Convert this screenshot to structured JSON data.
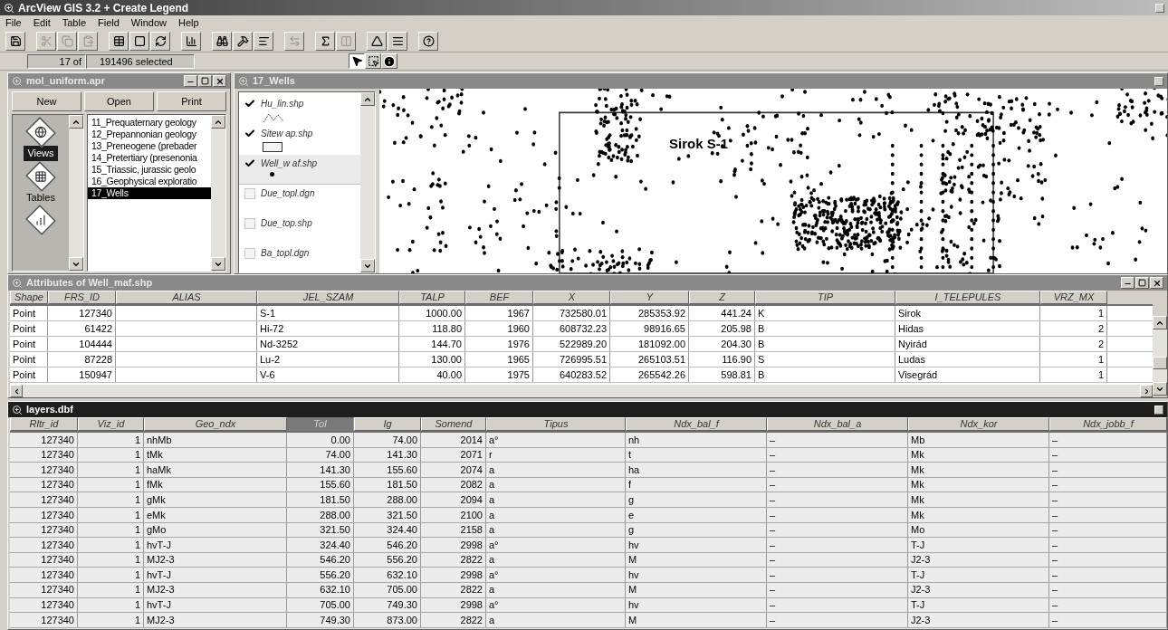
{
  "app": {
    "title": "ArcView GIS 3.2  + Create Legend"
  },
  "menu": [
    "File",
    "Edit",
    "Table",
    "Field",
    "Window",
    "Help"
  ],
  "status": {
    "count": "17 of",
    "selected": "191496 selected"
  },
  "tools": [
    {
      "kind": "pointer",
      "selected": true
    },
    {
      "kind": "vertex",
      "selected": false
    },
    {
      "kind": "identify",
      "selected": false
    }
  ],
  "project": {
    "title": "mol_uniform.apr",
    "buttons": [
      "New",
      "Open",
      "Print"
    ],
    "doc_types": [
      {
        "kind": "views",
        "label": "Views",
        "selected": true
      },
      {
        "kind": "tables",
        "label": "Tables",
        "selected": false
      },
      {
        "kind": "charts",
        "selected": false
      }
    ],
    "items": [
      {
        "label": "11_Prequaternary geology",
        "selected": false
      },
      {
        "label": "12_Prepannonian geology",
        "selected": false
      },
      {
        "label": "13_Preneogene (prebader",
        "selected": false
      },
      {
        "label": "14_Pretertiary (presenonia",
        "selected": false
      },
      {
        "label": "15_Triassic, jurassic geolo",
        "selected": false
      },
      {
        "label": "16_Geophysical exploratio",
        "selected": false
      },
      {
        "label": "17_Wells",
        "selected": true
      }
    ]
  },
  "view": {
    "title": "17_Wells",
    "map_label": "Sirok S-1",
    "legend": [
      {
        "name": "Hu_lin.shp",
        "checked": true,
        "kind": "line",
        "selected": false
      },
      {
        "name": "Sitew ap.shp",
        "checked": true,
        "kind": "polygon",
        "selected": false
      },
      {
        "name": "Well_w af.shp",
        "checked": true,
        "kind": "point",
        "selected": true
      },
      {
        "name": "Due_topl.dgn",
        "checked": false,
        "kind": "none",
        "selected": false
      },
      {
        "name": "Due_top.shp",
        "checked": false,
        "kind": "none",
        "selected": false
      },
      {
        "name": "Ba_topl.dgn",
        "checked": false,
        "kind": "none",
        "selected": false
      }
    ]
  },
  "attributes": {
    "title": "Attributes of Well_maf.shp",
    "columns": [
      {
        "label": "Shape",
        "kind": "text"
      },
      {
        "label": "FRS_ID",
        "kind": "number"
      },
      {
        "label": "ALIAS",
        "kind": "text"
      },
      {
        "label": "JEL_SZAM",
        "kind": "text"
      },
      {
        "label": "TALP",
        "kind": "number"
      },
      {
        "label": "BEF",
        "kind": "number"
      },
      {
        "label": "X",
        "kind": "number"
      },
      {
        "label": "Y",
        "kind": "number"
      },
      {
        "label": "Z",
        "kind": "number"
      },
      {
        "label": "TIP",
        "kind": "text"
      },
      {
        "label": "I_TELEPULES",
        "kind": "text"
      },
      {
        "label": "VRZ_MX",
        "kind": "number"
      }
    ],
    "rows": [
      [
        "Point",
        "127340",
        "",
        "S-1",
        "1000.00",
        "1967",
        "732580.01",
        "285353.92",
        "441.24",
        "K",
        "Sirok",
        "1"
      ],
      [
        "Point",
        "61422",
        "",
        "Hi-72",
        "118.80",
        "1960",
        "608732.23",
        "98916.65",
        "205.98",
        "B",
        "Hidas",
        "2"
      ],
      [
        "Point",
        "104444",
        "",
        "Nd-3252",
        "144.70",
        "1976",
        "522989.20",
        "181092.00",
        "204.30",
        "B",
        "Nyirád",
        "2"
      ],
      [
        "Point",
        "87228",
        "",
        "Lu-2",
        "130.00",
        "1965",
        "726995.51",
        "265103.51",
        "116.90",
        "S",
        "Ludas",
        "1"
      ],
      [
        "Point",
        "150947",
        "",
        "V-6",
        "40.00",
        "1975",
        "640283.52",
        "265542.26",
        "598.81",
        "B",
        "Visegrád",
        "1"
      ]
    ]
  },
  "layers": {
    "title": "layers.dbf",
    "columns": [
      {
        "label": "Rltr_id",
        "kind": "number",
        "selected": false
      },
      {
        "label": "Viz_id",
        "kind": "number",
        "selected": false
      },
      {
        "label": "Geo_ndx",
        "kind": "text",
        "selected": false
      },
      {
        "label": "Tol",
        "kind": "number",
        "selected": true
      },
      {
        "label": "Ig",
        "kind": "number",
        "selected": false
      },
      {
        "label": "Somend",
        "kind": "number",
        "selected": false
      },
      {
        "label": "Tipus",
        "kind": "text",
        "selected": false
      },
      {
        "label": "Ndx_bal_f",
        "kind": "text",
        "selected": false
      },
      {
        "label": "Ndx_bal_a",
        "kind": "text",
        "selected": false
      },
      {
        "label": "Ndx_kor",
        "kind": "text",
        "selected": false
      },
      {
        "label": "Ndx_jobb_f",
        "kind": "text",
        "selected": false
      }
    ],
    "rows": [
      [
        "127340",
        "1",
        "nhMb",
        "0.00",
        "74.00",
        "2014",
        "a°",
        "nh",
        "–",
        "Mb",
        "–"
      ],
      [
        "127340",
        "1",
        "tMk",
        "74.00",
        "141.30",
        "2071",
        "r",
        "t",
        "–",
        "Mk",
        "–"
      ],
      [
        "127340",
        "1",
        "haMk",
        "141.30",
        "155.60",
        "2074",
        "a",
        "ha",
        "–",
        "Mk",
        "–"
      ],
      [
        "127340",
        "1",
        "fMk",
        "155.60",
        "181.50",
        "2082",
        "a",
        "f",
        "–",
        "Mk",
        "–"
      ],
      [
        "127340",
        "1",
        "gMk",
        "181.50",
        "288.00",
        "2094",
        "a",
        "g",
        "–",
        "Mk",
        "–"
      ],
      [
        "127340",
        "1",
        "eMk",
        "288.00",
        "321.50",
        "2100",
        "a",
        "e",
        "–",
        "Mk",
        "–"
      ],
      [
        "127340",
        "1",
        "gMo",
        "321.50",
        "324.40",
        "2158",
        "a",
        "g",
        "–",
        "Mo",
        "–"
      ],
      [
        "127340",
        "1",
        "hvT-J",
        "324.40",
        "546.20",
        "2998",
        "a°",
        "hv",
        "–",
        "T-J",
        "–"
      ],
      [
        "127340",
        "1",
        "MJ2-3",
        "546.20",
        "556.20",
        "2822",
        "a",
        "M",
        "–",
        "J2-3",
        "–"
      ],
      [
        "127340",
        "1",
        "hvT-J",
        "556.20",
        "632.10",
        "2998",
        "a°",
        "hv",
        "–",
        "T-J",
        "–"
      ],
      [
        "127340",
        "1",
        "MJ2-3",
        "632.10",
        "705.00",
        "2822",
        "a",
        "M",
        "–",
        "J2-3",
        "–"
      ],
      [
        "127340",
        "1",
        "hvT-J",
        "705.00",
        "749.30",
        "2998",
        "a°",
        "hv",
        "–",
        "T-J",
        "–"
      ],
      [
        "127340",
        "1",
        "MJ2-3",
        "749.30",
        "873.00",
        "2822",
        "a",
        "M",
        "–",
        "J2-3",
        "–"
      ]
    ]
  }
}
